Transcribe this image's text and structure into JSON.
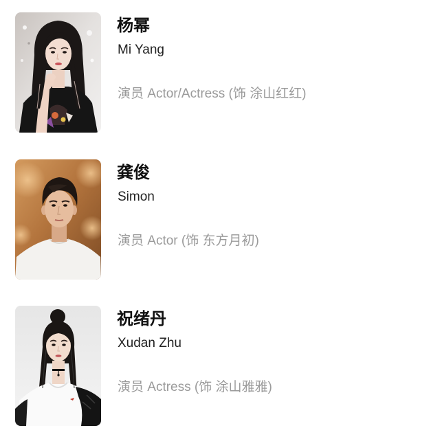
{
  "colors": {
    "background": "#ffffff",
    "name_text": "#111111",
    "english_name_text": "#222222",
    "role_text": "#9a9a9a"
  },
  "cast": [
    {
      "name_cn": "杨幂",
      "name_en": "Mi Yang",
      "role": "演员 Actor/Actress (饰 涂山红红)"
    },
    {
      "name_cn": "龚俊",
      "name_en": "Simon",
      "role": "演员 Actor (饰 东方月初)"
    },
    {
      "name_cn": "祝绪丹",
      "name_en": "Xudan Zhu",
      "role": "演员 Actress (饰 涂山雅雅)"
    }
  ]
}
